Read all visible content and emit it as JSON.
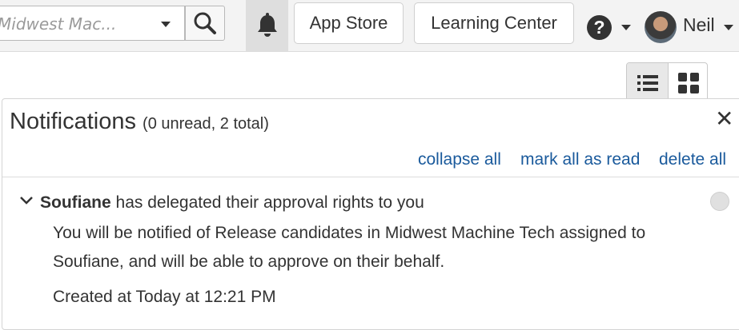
{
  "topbar": {
    "workspace_select": {
      "value": "Midwest Mac..."
    },
    "icons": {
      "search": "search-icon",
      "bell": "bell-icon",
      "help": "help-icon"
    },
    "app_store_label": "App Store",
    "learning_center_label": "Learning Center",
    "user": {
      "name": "Neil"
    }
  },
  "view_toggle": {
    "options": [
      "list-view-icon",
      "grid-view-icon"
    ],
    "selected": "list"
  },
  "notifications": {
    "title": "Notifications",
    "counts": "(0 unread, 2 total)",
    "actions": {
      "collapse_all": "collapse all",
      "mark_all_read": "mark all as read",
      "delete_all": "delete all"
    },
    "items": [
      {
        "sender": "Soufiane",
        "summary": " has delegated their approval rights to you",
        "body": "You will be notified of Release candidates in Midwest Machine Tech assigned to Soufiane, and will be able to approve on their behalf.",
        "created": "Created at Today at 12:21 PM",
        "read": true
      }
    ]
  },
  "colors": {
    "link": "#1a5a9c",
    "topbar_bg": "#f3f3f3",
    "bell_active_bg": "#dedede",
    "text": "#333333"
  }
}
